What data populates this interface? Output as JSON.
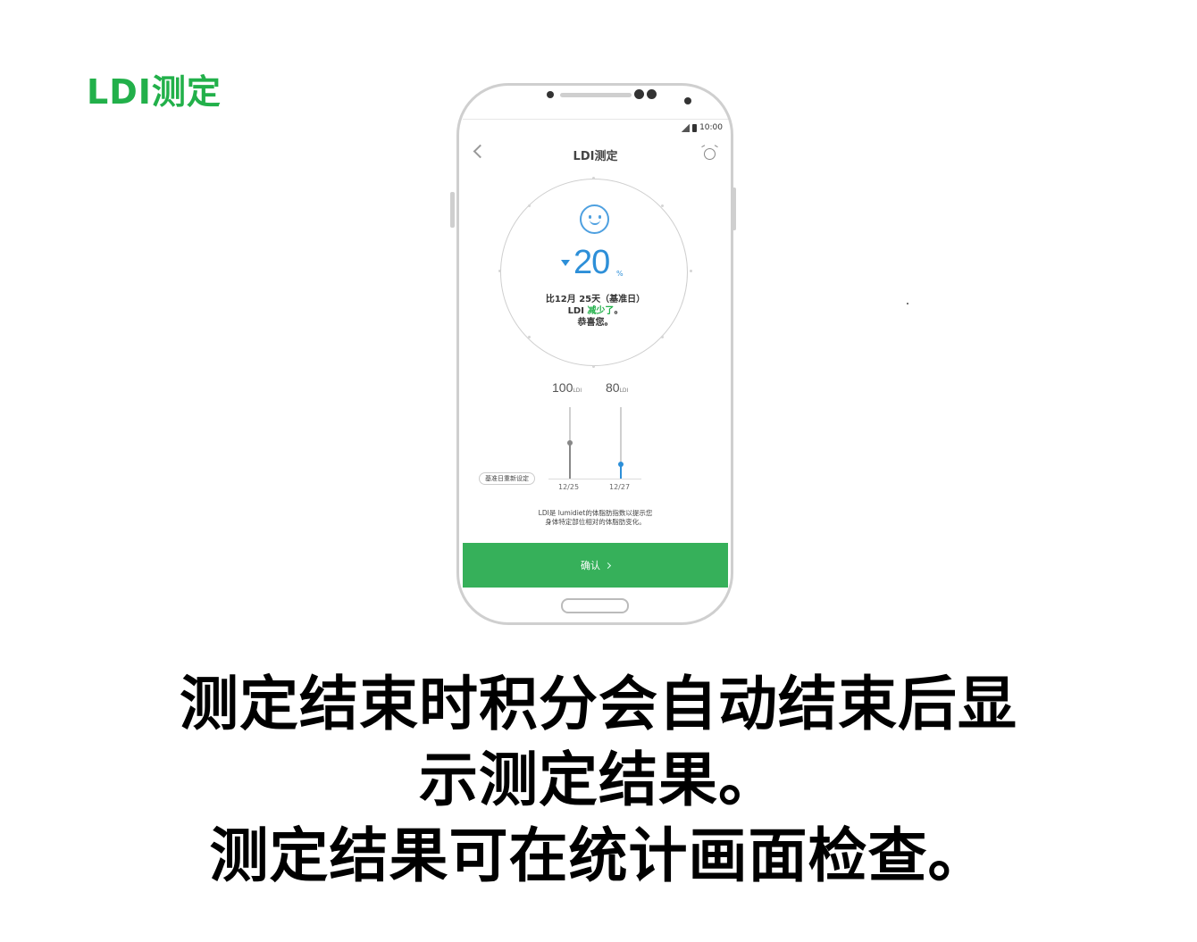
{
  "page_title": "LDI测定",
  "phone": {
    "status_time": "10:00",
    "app_title": "LDI测定",
    "result": {
      "value": "20",
      "unit": "%",
      "direction": "down",
      "line1": "比12月 25天（基准日）",
      "line2_prefix": "LDI ",
      "line2_highlight": "减少了",
      "line2_suffix": "。",
      "line3": "恭喜您。"
    },
    "bars": [
      {
        "value": "100",
        "unit": "LDI",
        "date": "12/25",
        "level": 0.5
      },
      {
        "value": "80",
        "unit": "LDI",
        "date": "12/27",
        "level": 0.2
      }
    ],
    "reset_label": "基准日重新设定",
    "note_line1": "LDI是 lumidiet的体脂肪指数以提示您",
    "note_line2": "身体特定部位相对的体脂肪变化。",
    "confirm_label": "确认"
  },
  "caption": {
    "line1": "测定结束时积分会自动结束后显",
    "line2": "示测定结果。",
    "line3": "测定结果可在统计画面检查。"
  },
  "colors": {
    "accent_green": "#22b04a",
    "button_green": "#36b05a",
    "value_blue": "#2d8fd8"
  },
  "icons": [
    "back-icon",
    "alarm-icon",
    "smile-icon",
    "down-arrow-icon",
    "chevron-right-icon"
  ]
}
